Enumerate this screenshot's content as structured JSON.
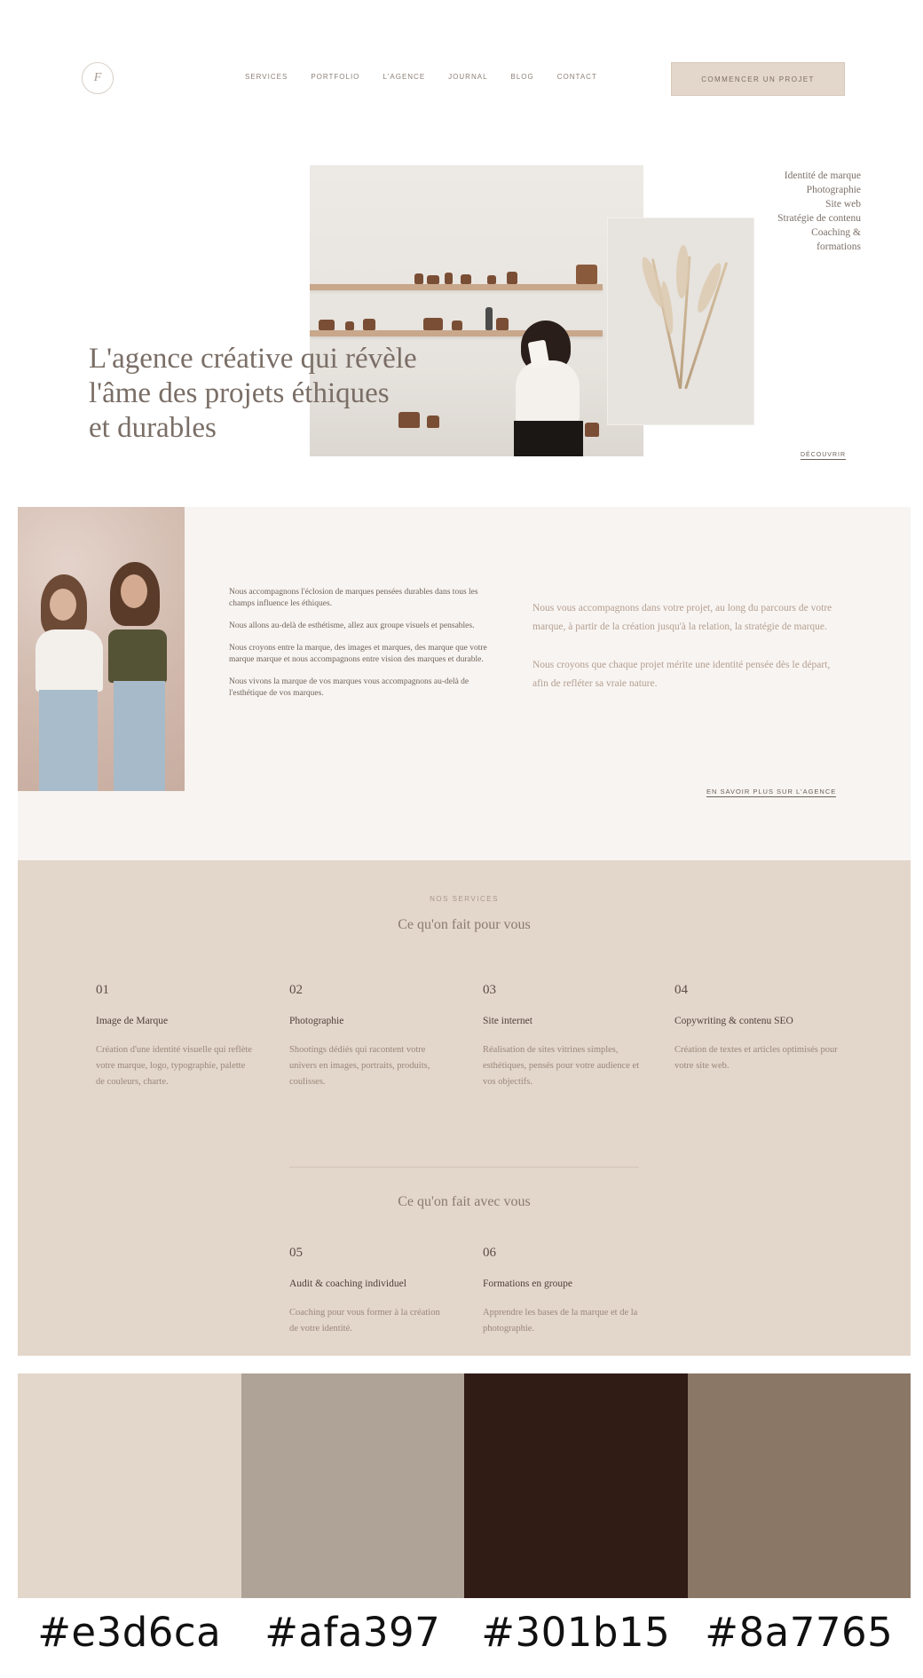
{
  "header": {
    "logo_mark": "F",
    "nav": [
      {
        "label": "SERVICES"
      },
      {
        "label": "PORTFOLIO"
      },
      {
        "label": "L'AGENCE"
      },
      {
        "label": "JOURNAL"
      },
      {
        "label": "BLOG"
      },
      {
        "label": "CONTACT"
      }
    ],
    "cta_label": "COMMENCER UN PROJET"
  },
  "hero": {
    "title_line1": "L'agence créative qui révèle",
    "title_line2": "l'âme des projets éthiques",
    "title_line3": "et durables",
    "side_links": [
      {
        "label": "Identité de marque"
      },
      {
        "label": "Photographie"
      },
      {
        "label": "Site web"
      },
      {
        "label": "Stratégie de contenu"
      },
      {
        "label": "Coaching &"
      },
      {
        "label": "formations"
      }
    ],
    "scroll_label": "DÉCOUVRIR"
  },
  "about": {
    "left_paragraphs": [
      "Nous accompagnons l'éclosion de marques pensées durables dans tous les champs influence les éthiques.",
      "Nous allons au-delà de esthétisme, allez aux groupe visuels et pensables.",
      "Nous croyons entre la marque, des images et marques, des marque que votre marque marque et nous accompagnons entre vision des marques et durable.",
      "Nous vivons la marque de vos marques vous accompagnons au-delà de l'esthétique de vos marques."
    ],
    "right_paragraphs": [
      "Nous vous accompagnons dans votre projet, au long du parcours de votre marque, à partir de la création jusqu'à la relation, la stratégie de marque.",
      "Nous croyons que chaque projet mérite une identité pensée dès le départ, afin de refléter sa vraie nature."
    ],
    "link_label": "EN SAVOIR PLUS SUR L'AGENCE"
  },
  "services": {
    "eyebrow": "NOS SERVICES",
    "heading_1": "Ce qu'on fait pour vous",
    "heading_2": "Ce qu'on fait avec vous",
    "row1": [
      {
        "num": "01",
        "title": "Image de Marque",
        "desc": "Création d'une identité visuelle qui reflète votre marque, logo, typographie, palette de couleurs, charte."
      },
      {
        "num": "02",
        "title": "Photographie",
        "desc": "Shootings dédiés qui racontent votre univers en images, portraits, produits, coulisses."
      },
      {
        "num": "03",
        "title": "Site internet",
        "desc": "Réalisation de sites vitrines simples, esthétiques, pensés pour votre audience et vos objectifs."
      },
      {
        "num": "04",
        "title": "Copywriting & contenu SEO",
        "desc": "Création de textes et articles optimisés pour votre site web."
      }
    ],
    "row2": [
      {
        "num": "05",
        "title": "Audit & coaching individuel",
        "desc": "Coaching pour vous former à la création de votre identité."
      },
      {
        "num": "06",
        "title": "Formations en groupe",
        "desc": "Apprendre les bases de la marque et de la photographie."
      }
    ]
  },
  "palette": {
    "colors": [
      "#e3d6ca",
      "#afa397",
      "#301b15",
      "#8a7765"
    ],
    "labels": [
      "#e3d6ca",
      "#afa397",
      "#301b15",
      "#8a7765"
    ]
  }
}
